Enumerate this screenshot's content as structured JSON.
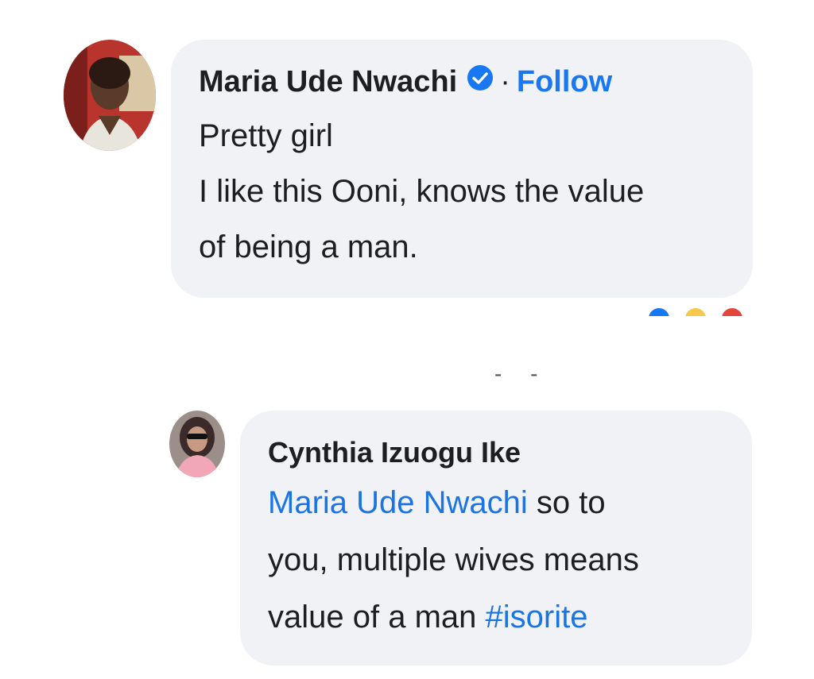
{
  "comments": [
    {
      "author": "Maria Ude Nwachi",
      "verified_icon": "verified-badge-icon",
      "separator": "·",
      "follow_label": "Follow",
      "lines": [
        "Pretty girl",
        "I like this Ooni, knows the value",
        "of being a man."
      ]
    },
    {
      "author": "Cynthia Izuogu Ike",
      "mention": "Maria Ude Nwachi",
      "line1_rest": " so to",
      "line2": "you, multiple wives means",
      "line3_text": "value of a man ",
      "hashtag": "#isorite"
    }
  ],
  "more_replies": "- -",
  "colors": {
    "bubble": "#f0f2f5",
    "link": "#1877f2",
    "text": "#1c1e21"
  }
}
